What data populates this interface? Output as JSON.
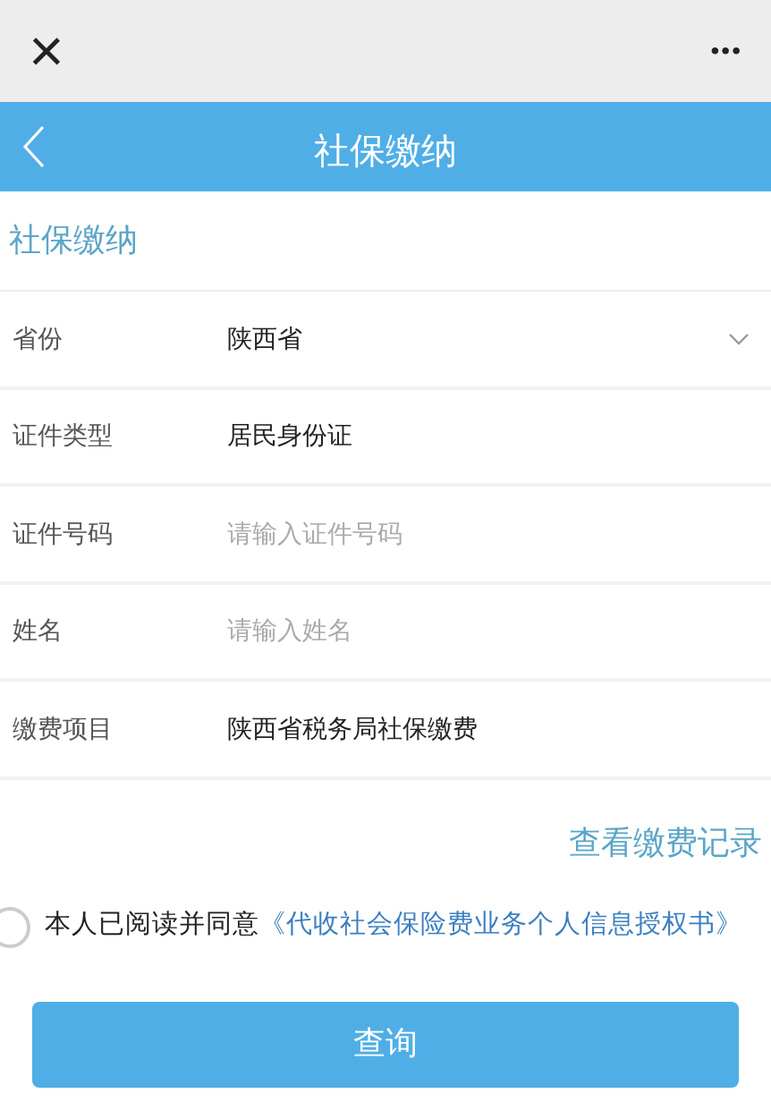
{
  "top_bar": {
    "close": "×",
    "more": "•••"
  },
  "header": {
    "title": "社保缴纳"
  },
  "section_title": "社保缴纳",
  "fields": [
    {
      "kind": "select",
      "label": "省份",
      "value": "陕西省"
    },
    {
      "kind": "text",
      "label": "证件类型",
      "value": "居民身份证"
    },
    {
      "kind": "input",
      "label": "证件号码",
      "placeholder": "请输入证件号码"
    },
    {
      "kind": "input",
      "label": "姓名",
      "placeholder": "请输入姓名"
    },
    {
      "kind": "text",
      "label": "缴费项目",
      "value": "陕西省税务局社保缴费"
    }
  ],
  "records_link": "查看缴费记录",
  "agreement": {
    "checked": false,
    "text": "本人已阅读并同意",
    "link": "《代收社会保险费业务个人信息授权书》"
  },
  "submit_button": "查询"
}
